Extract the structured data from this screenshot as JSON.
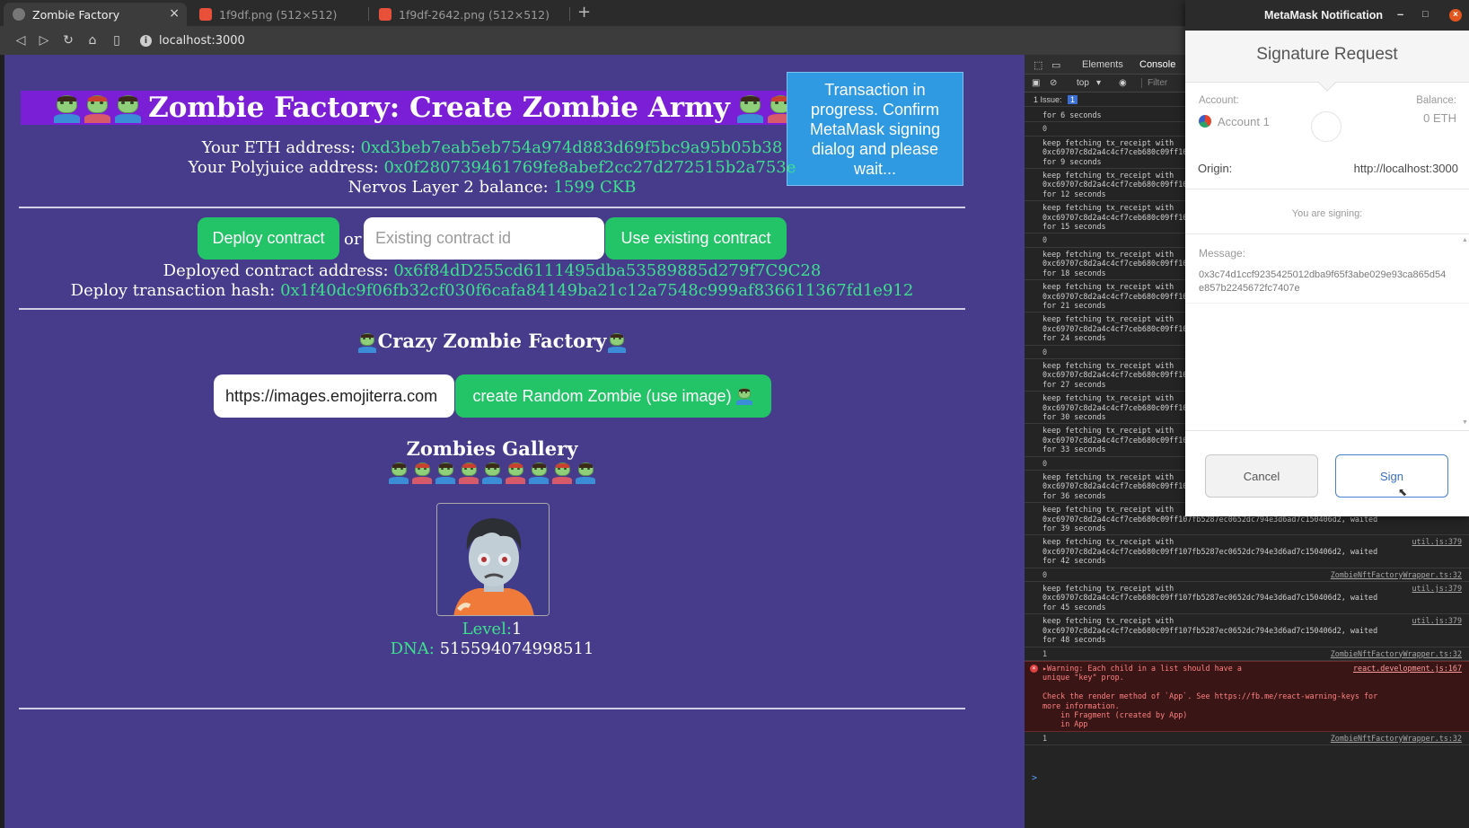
{
  "browser": {
    "tabs": [
      {
        "label": "Zombie Factory",
        "active": true
      },
      {
        "label": "1f9df.png (512×512)",
        "active": false
      },
      {
        "label": "1f9df-2642.png (512×512)",
        "active": false
      }
    ],
    "new_tab_symbol": "+",
    "url": "localhost:3000"
  },
  "page": {
    "title": "Zombie Factory: Create Zombie Army",
    "eth_label": "Your ETH address: ",
    "eth_value": "0xd3beb7eab5eb754a974d883d69f5bc9a95b05b38",
    "polyjuice_label": "Your Polyjuice address: ",
    "polyjuice_value": "0x0f280739461769fe8abef2cc27d272515b2a753e",
    "balance_label": "Nervos Layer 2 balance: ",
    "balance_value": "1599 CKB",
    "deploy_button": "Deploy contract",
    "or_text": "or",
    "contract_input_placeholder": "Existing contract id",
    "use_existing_button": "Use existing contract",
    "deployed_label": "Deployed contract address: ",
    "deployed_value": "0x6f84dD255cd6111495dba53589885d279f7C9C28",
    "deploy_tx_label": "Deploy transaction hash: ",
    "deploy_tx_value": "0x1f40dc9f06fb32cf030f6cafa84149ba21c12a7548c999af836611367fd1e912",
    "factory_heading": "Crazy Zombie Factory",
    "image_url_value": "https://images.emojiterra.com",
    "create_button": "create Random Zombie (use image)",
    "gallery_heading": "Zombies Gallery",
    "gallery_icon_count": 9,
    "level_label": "Level:",
    "level_value": "1",
    "dna_label": "DNA: ",
    "dna_value": "515594074998511",
    "notification": "Transaction in progress. Confirm MetaMask signing dialog and please wait...",
    "colors": {
      "accent_green": "#3ee08f",
      "button_green": "#22c467",
      "page_bg": "#473b8b",
      "banner_bg": "#7b1fd6",
      "notify_bg": "#2f9ae2"
    }
  },
  "devtools": {
    "tabs": [
      "Elements",
      "Console"
    ],
    "context": "top",
    "filter_placeholder": "Filter",
    "issues": "1 Issue:",
    "issues_count": "1",
    "log": [
      {
        "type": "text",
        "text": "for 6 seconds"
      },
      {
        "type": "num",
        "text": "0"
      },
      {
        "type": "text",
        "text": "keep fetching tx_receipt with\n0xc69707c8d2a4c4cf7ceb680c09ff107fb5287ec0652dc794e3d6ad7c150406d2, waited\nfor 9 seconds"
      },
      {
        "type": "text",
        "text": "keep fetching tx_receipt with\n0xc69707c8d2a4c4cf7ceb680c09ff107fb5287ec0652dc794e3d6ad7c150406d2, waited\nfor 12 seconds"
      },
      {
        "type": "text",
        "text": "keep fetching tx_receipt with\n0xc69707c8d2a4c4cf7ceb680c09ff107fb5287ec0652dc794e3d6ad7c150406d2, waited\nfor 15 seconds"
      },
      {
        "type": "num",
        "text": "0"
      },
      {
        "type": "text",
        "text": "keep fetching tx_receipt with\n0xc69707c8d2a4c4cf7ceb680c09ff107fb5287ec0652dc794e3d6ad7c150406d2, waited\nfor 18 seconds"
      },
      {
        "type": "text",
        "text": "keep fetching tx_receipt with\n0xc69707c8d2a4c4cf7ceb680c09ff107fb5287ec0652dc794e3d6ad7c150406d2, waited\nfor 21 seconds"
      },
      {
        "type": "text",
        "text": "keep fetching tx_receipt with\n0xc69707c8d2a4c4cf7ceb680c09ff107fb5287ec0652dc794e3d6ad7c150406d2, waited\nfor 24 seconds"
      },
      {
        "type": "num",
        "text": "0"
      },
      {
        "type": "text",
        "text": "keep fetching tx_receipt with\n0xc69707c8d2a4c4cf7ceb680c09ff107fb5287ec0652dc794e3d6ad7c150406d2, waited\nfor 27 seconds"
      },
      {
        "type": "text",
        "text": "keep fetching tx_receipt with\n0xc69707c8d2a4c4cf7ceb680c09ff107fb5287ec0652dc794e3d6ad7c150406d2, waited\nfor 30 seconds"
      },
      {
        "type": "text",
        "text": "keep fetching tx_receipt with\n0xc69707c8d2a4c4cf7ceb680c09ff107fb5287ec0652dc794e3d6ad7c150406d2, waited\nfor 33 seconds"
      },
      {
        "type": "num",
        "text": "0"
      },
      {
        "type": "text",
        "text": "keep fetching tx_receipt with\n0xc69707c8d2a4c4cf7ceb680c09ff107fb5287ec0652dc794e3d6ad7c150406d2, waited\nfor 36 seconds"
      },
      {
        "type": "text",
        "text": "keep fetching tx_receipt with\n0xc69707c8d2a4c4cf7ceb680c09ff107fb5287ec0652dc794e3d6ad7c150406d2, waited\nfor 39 seconds",
        "src": "util.js:379"
      },
      {
        "type": "text",
        "text": "keep fetching tx_receipt with\n0xc69707c8d2a4c4cf7ceb680c09ff107fb5287ec0652dc794e3d6ad7c150406d2, waited\nfor 42 seconds",
        "src": "util.js:379"
      },
      {
        "type": "num",
        "text": "0",
        "src": "ZombieNftFactoryWrapper.ts:32"
      },
      {
        "type": "text",
        "text": "keep fetching tx_receipt with\n0xc69707c8d2a4c4cf7ceb680c09ff107fb5287ec0652dc794e3d6ad7c150406d2, waited\nfor 45 seconds",
        "src": "util.js:379"
      },
      {
        "type": "text",
        "text": "keep fetching tx_receipt with\n0xc69707c8d2a4c4cf7ceb680c09ff107fb5287ec0652dc794e3d6ad7c150406d2, waited\nfor 48 seconds",
        "src": "util.js:379"
      },
      {
        "type": "num",
        "text": "1",
        "src": "ZombieNftFactoryWrapper.ts:32"
      },
      {
        "type": "warn",
        "text": "▸Warning: Each child in a list should have a\nunique \"key\" prop.\n\nCheck the render method of `App`. See https://fb.me/react-warning-keys for\nmore information.\n    in Fragment (created by App)\n    in App",
        "src": "react.development.js:167"
      },
      {
        "type": "num",
        "text": "1",
        "src": "ZombieNftFactoryWrapper.ts:32"
      }
    ],
    "prompt": ">"
  },
  "metamask": {
    "window_title": "MetaMask Notification",
    "heading": "Signature Request",
    "account_label": "Account:",
    "account_name": "Account 1",
    "balance_label": "Balance:",
    "balance_value": "0 ETH",
    "origin_label": "Origin:",
    "origin_value": "http://localhost:3000",
    "signing_text": "You are signing:",
    "message_label": "Message:",
    "message_value": "0x3c74d1ccf9235425012dba9f65f3abe029e93ca865d54e857b2245672fc7407e",
    "cancel_button": "Cancel",
    "sign_button": "Sign"
  }
}
